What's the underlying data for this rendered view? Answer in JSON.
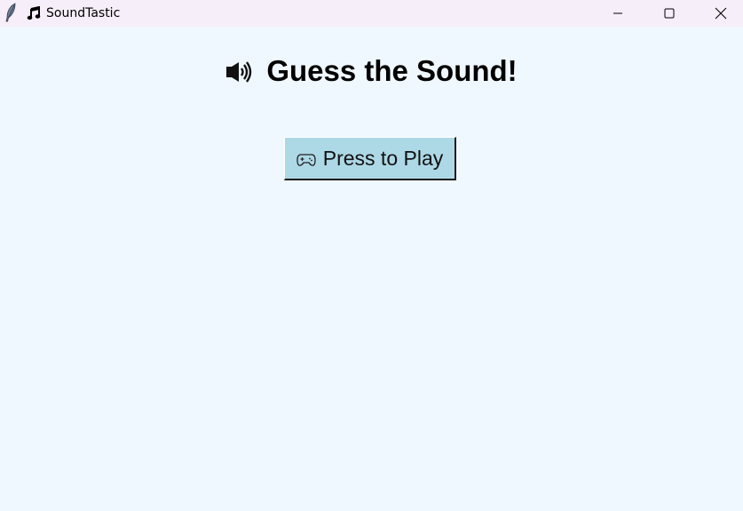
{
  "window": {
    "title": "SoundTastic",
    "app_icon": "feather-icon",
    "title_icon": "music-note-icon",
    "controls": {
      "minimize": "minimize-icon",
      "maximize": "maximize-icon",
      "close": "close-icon"
    }
  },
  "main": {
    "heading_icon": "speaker-icon",
    "heading": "Guess the Sound!",
    "play_button": {
      "icon": "gamepad-icon",
      "label": "Press to Play"
    }
  },
  "colors": {
    "background": "#f0f8ff",
    "titlebar": "#f6eef8",
    "button": "#add8e6"
  }
}
